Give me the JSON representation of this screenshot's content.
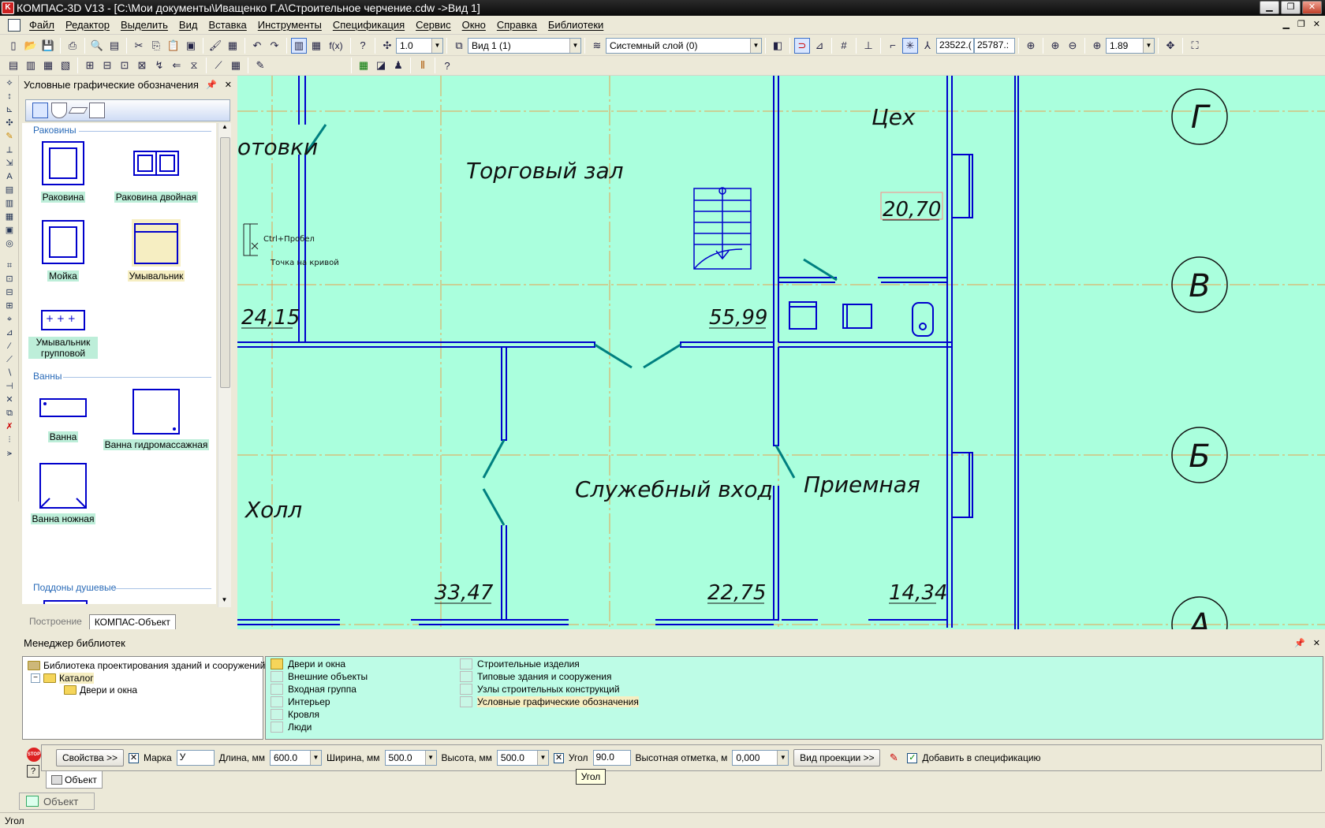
{
  "titlebar": {
    "title": "КОМПАС-3D V13 - [C:\\Мои документы\\Иващенко Г.А\\Строительное черчение.cdw ->Вид 1]"
  },
  "menu": [
    "Файл",
    "Редактор",
    "Выделить",
    "Вид",
    "Вставка",
    "Инструменты",
    "Спецификация",
    "Сервис",
    "Окно",
    "Справка",
    "Библиотеки"
  ],
  "toolbar": {
    "scale_value": "1.0",
    "view_value": "Вид 1 (1)",
    "layer_value": "Системный слой (0)",
    "coord_x": "23522.(",
    "coord_y": "25787.:",
    "zoom_value": "1.89",
    "fx_label": "f(x)"
  },
  "library_panel": {
    "title": "Условные графические обозначения",
    "groups": [
      {
        "title": "Раковины",
        "items": [
          "Раковина",
          "Раковина двойная",
          "Мойка",
          "Умывальник",
          "Умывальник групповой"
        ]
      },
      {
        "title": "Ванны",
        "items": [
          "Ванна",
          "Ванна гидромассажная",
          "Ванна ножная"
        ]
      },
      {
        "title": "Поддоны душевые",
        "items": []
      }
    ],
    "tabs": [
      "Построение",
      "КОМПАС-Объект"
    ]
  },
  "drawing": {
    "rooms": [
      "отовки",
      "Торговый зал",
      "Цех",
      "Холл",
      "Служебный вход",
      "Приемная"
    ],
    "areas": [
      "24,15",
      "55,99",
      "20,70",
      "33,47",
      "22,75",
      "14,34"
    ],
    "axes": [
      "Г",
      "В",
      "Б",
      "А"
    ],
    "cursor_hint": "Ctrl+Пробел",
    "snap_hint": "Точка на кривой"
  },
  "library_manager": {
    "title": "Менеджер библиотек",
    "tree": [
      "Библиотека проектирования зданий и сооружений",
      "Каталог",
      "Двери и окна"
    ],
    "list_col1": [
      "Двери и окна",
      "Внешние объекты",
      "Входная группа",
      "Интерьер",
      "Кровля",
      "Люди"
    ],
    "list_col2": [
      "Строительные изделия",
      "Типовые здания и сооружения",
      "Узлы строительных конструкций",
      "Условные графические обозначения"
    ]
  },
  "property_bar": {
    "properties_btn": "Свойства",
    "mark_label": "Марка",
    "mark_value": "У",
    "length_label": "Длина, мм",
    "length_value": "600.0",
    "width_label": "Ширина, мм",
    "width_value": "500.0",
    "height_label": "Высота, мм",
    "height_value": "500.0",
    "angle_label": "Угол",
    "angle_value": "90.0",
    "elevation_label": "Высотная отметка, м",
    "elevation_value": "0,000",
    "projection_btn": "Вид проекции",
    "spec_label": "Добавить в спецификацию",
    "tooltip": "Угол",
    "object_tab": "Объект"
  },
  "bottom_tab": "Объект",
  "status": "Угол",
  "colors": {
    "canvas": "#aaffdd",
    "wall": "#0000cc",
    "door": "#008080",
    "axis": "#e8a050"
  }
}
